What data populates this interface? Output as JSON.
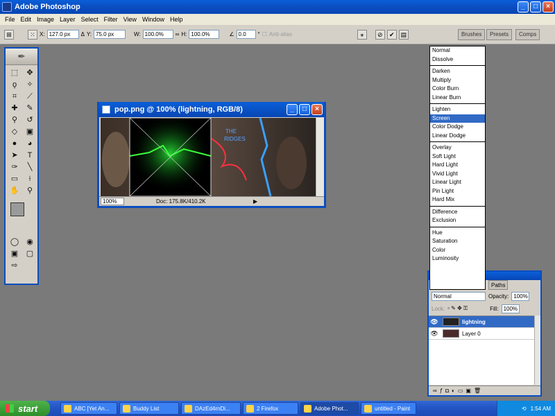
{
  "app": {
    "title": "Adobe Photoshop"
  },
  "window_buttons": {
    "minimize": "_",
    "maximize": "□",
    "close": "×"
  },
  "menu": [
    "File",
    "Edit",
    "Image",
    "Layer",
    "Select",
    "Filter",
    "View",
    "Window",
    "Help"
  ],
  "options": {
    "x_label": "X:",
    "x_value": "127.0 px",
    "y_label": "Y:",
    "y_value": "75.0 px",
    "w_label": "W:",
    "w_value": "100.0%",
    "h_label": "H:",
    "h_value": "100.0%",
    "angle_value": "0.0",
    "angle_unit": "°",
    "antialias_label": "Anti-alias"
  },
  "palette_well": {
    "brushes": "Brushes",
    "presets": "Presets",
    "comps": "Comps"
  },
  "document": {
    "title": "pop.png @ 100% (lightning, RGB/8)",
    "zoom": "100%",
    "doc_size": "Doc: 175.8K/410.2K",
    "image_text_line1": "THE",
    "image_text_line2": "RIDGES"
  },
  "blend_modes": {
    "groups": [
      [
        "Normal",
        "Dissolve"
      ],
      [
        "Darken",
        "Multiply",
        "Color Burn",
        "Linear Burn"
      ],
      [
        "Lighten",
        "Screen",
        "Color Dodge",
        "Linear Dodge"
      ],
      [
        "Overlay",
        "Soft Light",
        "Hard Light",
        "Vivid Light",
        "Linear Light",
        "Pin Light",
        "Hard Mix"
      ],
      [
        "Difference",
        "Exclusion"
      ],
      [
        "Hue",
        "Saturation",
        "Color",
        "Luminosity"
      ]
    ],
    "selected": "Screen"
  },
  "layers_panel": {
    "tab_paths": "Paths",
    "blend_mode": "Normal",
    "opacity_label": "Opacity:",
    "opacity_value": "100%",
    "lock_label": "Lock:",
    "fill_label": "Fill:",
    "fill_value": "100%",
    "layers": [
      {
        "name": "lightning",
        "selected": true
      },
      {
        "name": "Layer 0",
        "selected": false
      }
    ]
  },
  "taskbar": {
    "start_label": "start",
    "tasks": [
      {
        "label": "ABC [Yet An...",
        "active": false
      },
      {
        "label": "Buddy List",
        "active": false
      },
      {
        "label": "DAzEd4rnDi...",
        "active": false
      },
      {
        "label": "2 Firefox",
        "active": false
      },
      {
        "label": "Adobe Phot...",
        "active": true
      },
      {
        "label": "untitled - Paint",
        "active": false
      }
    ],
    "clock": "1:54 AM"
  },
  "colors": {
    "title_blue": "#0a4ec0",
    "selection_blue": "#316ac5",
    "workspace_gray": "#7a7a7a",
    "foreground_swatch": "#9a9a9a",
    "background_swatch": "#000000"
  }
}
